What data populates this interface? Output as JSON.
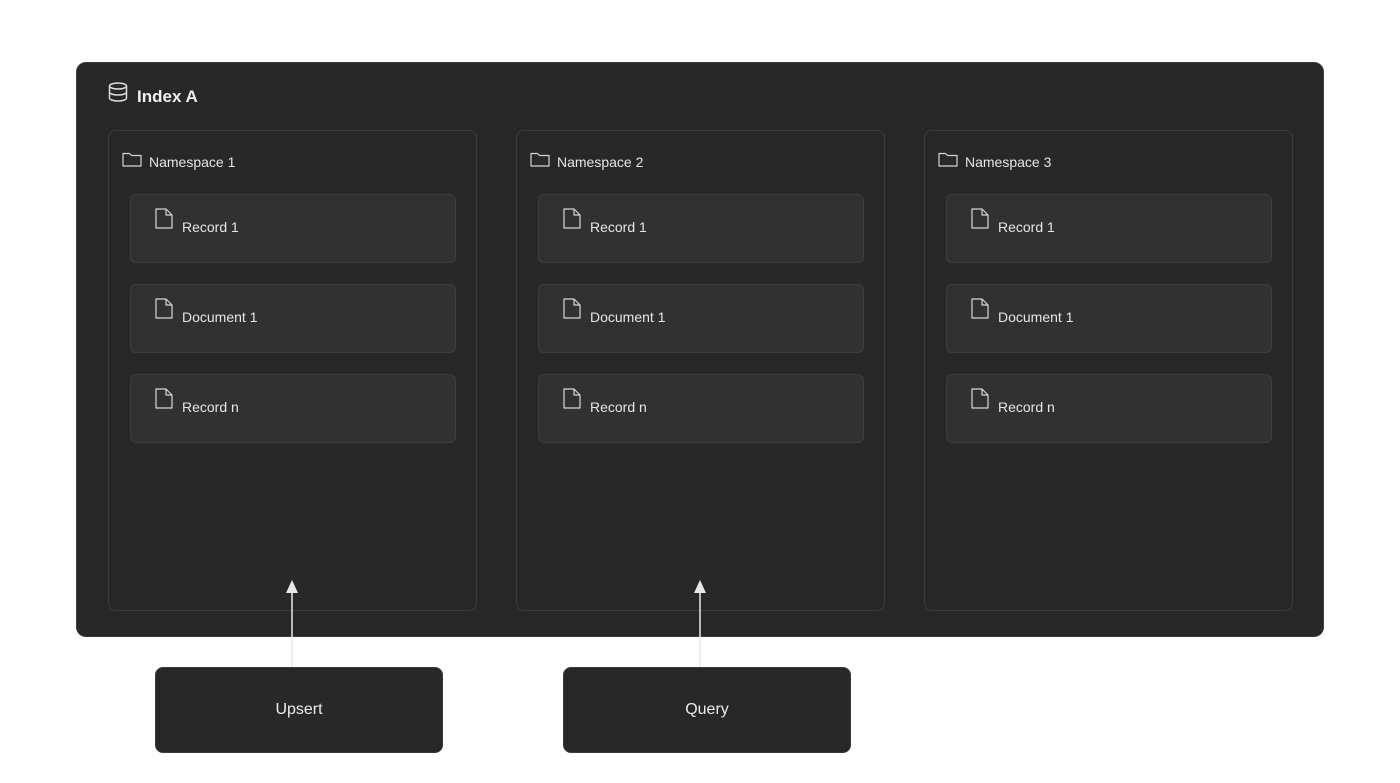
{
  "index": {
    "title": "Index A",
    "icon": "database-icon"
  },
  "namespaces": [
    {
      "label": "Namespace 1",
      "icon": "folder-icon",
      "records": [
        {
          "label": "Record 1",
          "icon": "file-icon"
        },
        {
          "label": "Document 1",
          "icon": "file-icon"
        },
        {
          "label": "Record n",
          "icon": "file-icon"
        }
      ]
    },
    {
      "label": "Namespace 2",
      "icon": "folder-icon",
      "records": [
        {
          "label": "Record 1",
          "icon": "file-icon"
        },
        {
          "label": "Document 1",
          "icon": "file-icon"
        },
        {
          "label": "Record n",
          "icon": "file-icon"
        }
      ]
    },
    {
      "label": "Namespace 3",
      "icon": "folder-icon",
      "records": [
        {
          "label": "Record 1",
          "icon": "file-icon"
        },
        {
          "label": "Document 1",
          "icon": "file-icon"
        },
        {
          "label": "Record n",
          "icon": "file-icon"
        }
      ]
    }
  ],
  "actions": [
    {
      "label": "Upsert",
      "target": "Namespace 1"
    },
    {
      "label": "Query",
      "target": "Namespace 2"
    }
  ],
  "colors": {
    "panel": "#282828",
    "record": "#313131",
    "border": "#3c3c3c",
    "text": "#ececec",
    "arrow": "#e8e8e8"
  }
}
